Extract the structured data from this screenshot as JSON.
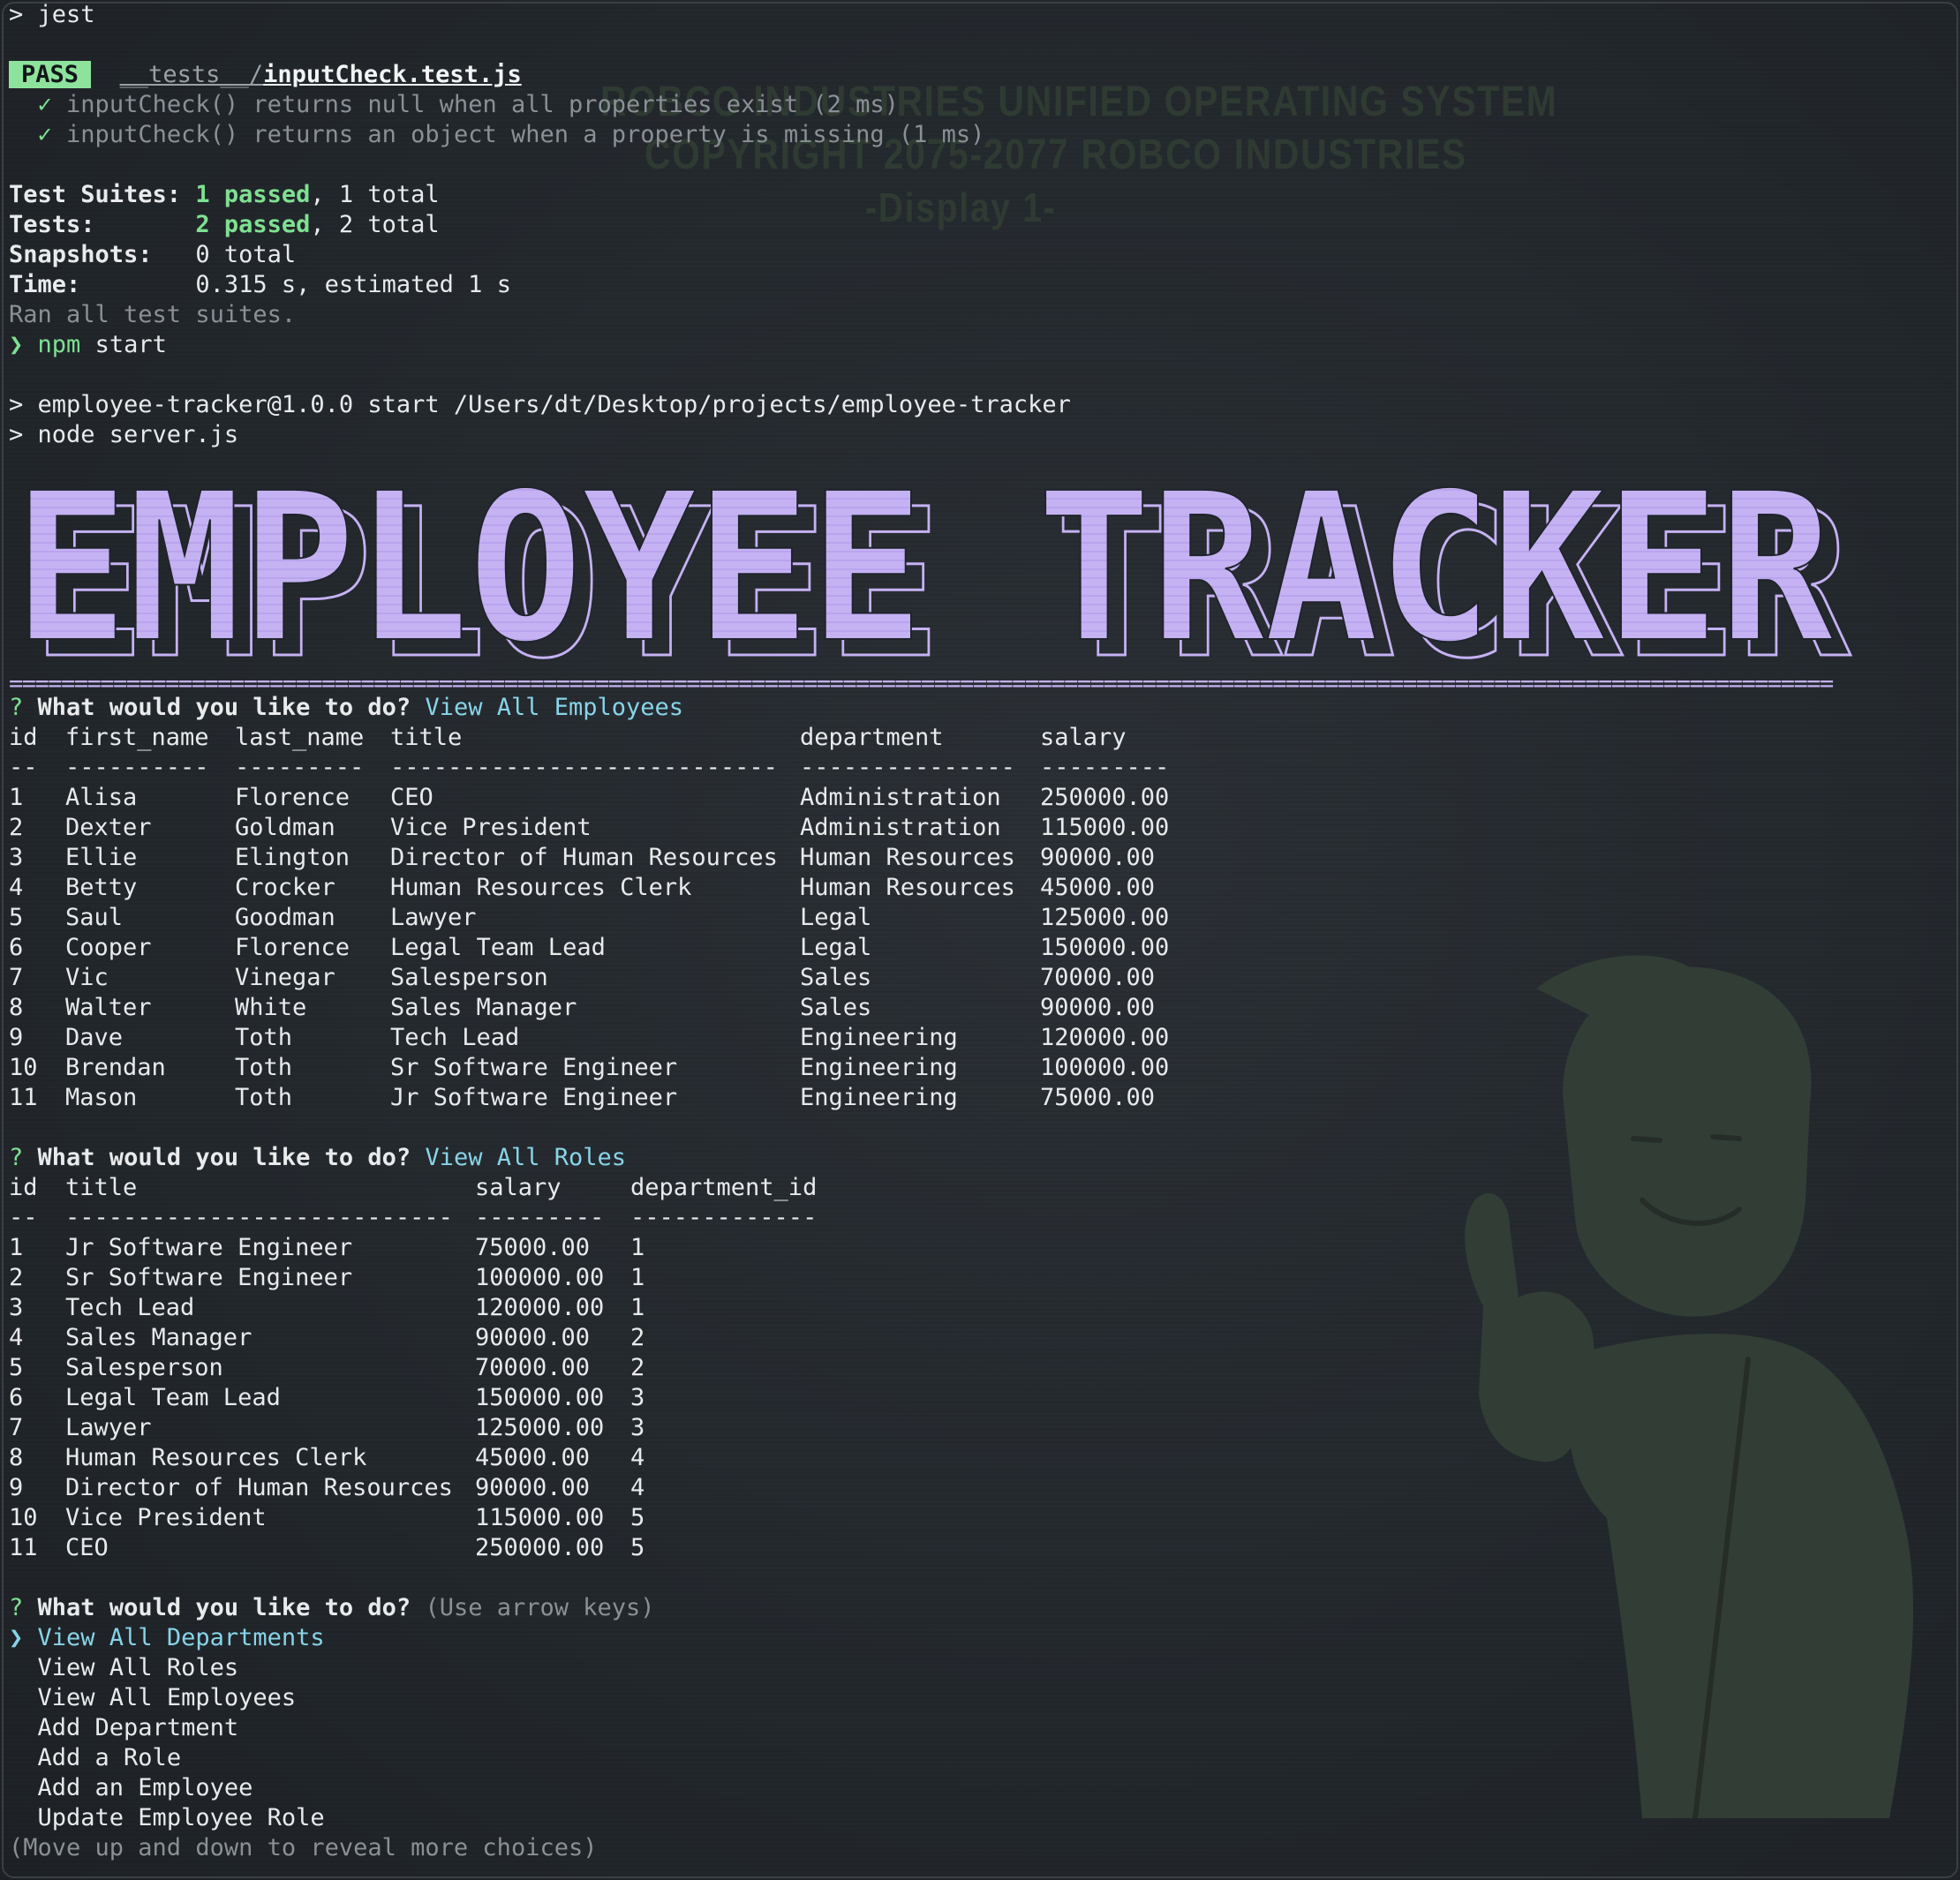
{
  "watermark": {
    "line1": "ROBCO INDUSTRIES UNIFIED OPERATING SYSTEM",
    "line2": "COPYRIGHT 2075-2077 ROBCO INDUSTRIES",
    "line3": "-Display 1-"
  },
  "jest": {
    "command": "> jest",
    "pass_badge": "PASS",
    "test_dir": "__tests__/",
    "test_file": "inputCheck.test.js",
    "checkmark": "✓",
    "results": [
      "inputCheck() returns null when all properties exist (2 ms)",
      "inputCheck() returns an object when a property is missing (1 ms)"
    ],
    "summary": {
      "suites_label": "Test Suites:",
      "suites_passed": "1 passed",
      "suites_total": ", 1 total",
      "tests_label": "Tests:",
      "tests_passed": "2 passed",
      "tests_total": ", 2 total",
      "snapshots_label": "Snapshots:",
      "snapshots_value": "0 total",
      "time_label": "Time:",
      "time_value": "0.315 s, estimated 1 s"
    },
    "ran_all": "Ran all test suites."
  },
  "npm": {
    "prompt_glyph": "❯",
    "cmd": "npm",
    "arg": "start",
    "line1": "> employee-tracker@1.0.0 start /Users/dt/Desktop/projects/employee-tracker",
    "line2": "> node server.js"
  },
  "banner": {
    "text": "EMPLOYEE TRACKER",
    "color": "#c5b2f3"
  },
  "separator_char": "=",
  "prompt1": {
    "mark": "?",
    "question": "What would you like to do?",
    "answer": "View All Employees"
  },
  "employees": {
    "headers": [
      "id",
      "first_name",
      "last_name",
      "title",
      "department",
      "salary"
    ],
    "dashes": [
      "--",
      "----------",
      "---------",
      "---------------------------",
      "---------------",
      "---------"
    ],
    "rows": [
      [
        "1",
        "Alisa",
        "Florence",
        "CEO",
        "Administration",
        "250000.00"
      ],
      [
        "2",
        "Dexter",
        "Goldman",
        "Vice President",
        "Administration",
        "115000.00"
      ],
      [
        "3",
        "Ellie",
        "Elington",
        "Director of Human Resources",
        "Human Resources",
        "90000.00"
      ],
      [
        "4",
        "Betty",
        "Crocker",
        "Human Resources Clerk",
        "Human Resources",
        "45000.00"
      ],
      [
        "5",
        "Saul",
        "Goodman",
        "Lawyer",
        "Legal",
        "125000.00"
      ],
      [
        "6",
        "Cooper",
        "Florence",
        "Legal Team Lead",
        "Legal",
        "150000.00"
      ],
      [
        "7",
        "Vic",
        "Vinegar",
        "Salesperson",
        "Sales",
        "70000.00"
      ],
      [
        "8",
        "Walter",
        "White",
        "Sales Manager",
        "Sales",
        "90000.00"
      ],
      [
        "9",
        "Dave",
        "Toth",
        "Tech Lead",
        "Engineering",
        "120000.00"
      ],
      [
        "10",
        "Brendan",
        "Toth",
        "Sr Software Engineer",
        "Engineering",
        "100000.00"
      ],
      [
        "11",
        "Mason",
        "Toth",
        "Jr Software Engineer",
        "Engineering",
        "75000.00"
      ]
    ]
  },
  "prompt2": {
    "mark": "?",
    "question": "What would you like to do?",
    "answer": "View All Roles"
  },
  "roles": {
    "headers": [
      "id",
      "title",
      "salary",
      "department_id"
    ],
    "dashes": [
      "--",
      "---------------------------",
      "---------",
      "-------------"
    ],
    "rows": [
      [
        "1",
        "Jr Software Engineer",
        "75000.00",
        "1"
      ],
      [
        "2",
        "Sr Software Engineer",
        "100000.00",
        "1"
      ],
      [
        "3",
        "Tech Lead",
        "120000.00",
        "1"
      ],
      [
        "4",
        "Sales Manager",
        "90000.00",
        "2"
      ],
      [
        "5",
        "Salesperson",
        "70000.00",
        "2"
      ],
      [
        "6",
        "Legal Team Lead",
        "150000.00",
        "3"
      ],
      [
        "7",
        "Lawyer",
        "125000.00",
        "3"
      ],
      [
        "8",
        "Human Resources Clerk",
        "45000.00",
        "4"
      ],
      [
        "9",
        "Director of Human Resources",
        "90000.00",
        "4"
      ],
      [
        "10",
        "Vice President",
        "115000.00",
        "5"
      ],
      [
        "11",
        "CEO",
        "250000.00",
        "5"
      ]
    ]
  },
  "prompt3": {
    "mark": "?",
    "question": "What would you like to do?",
    "hint": "(Use arrow keys)",
    "pointer": "❯",
    "choices": [
      "View All Departments",
      "View All Roles",
      "View All Employees",
      "Add Department",
      "Add a Role",
      "Add an Employee",
      "Update Employee Role"
    ],
    "footer": "(Move up and down to reveal more choices)"
  }
}
